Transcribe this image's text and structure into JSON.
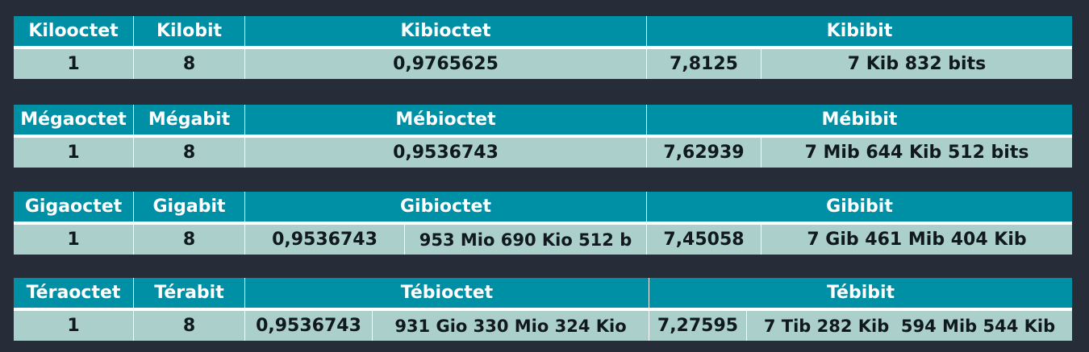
{
  "tables": [
    {
      "headers": [
        "Kilooctet",
        "Kilobit",
        "Kibioctet",
        "Kibibit"
      ],
      "values": [
        "1",
        "8",
        "0,9765625",
        "7,8125",
        "7 Kib 832 bits"
      ]
    },
    {
      "headers": [
        "Mégaoctet",
        "Mégabit",
        "Mébioctet",
        "Mébibit"
      ],
      "values": [
        "1",
        "8",
        "0,9536743",
        "7,62939",
        "7 Mib 644 Kib 512 bits"
      ]
    },
    {
      "headers": [
        "Gigaoctet",
        "Gigabit",
        "Gibioctet",
        "Gibibit"
      ],
      "values": [
        "1",
        "8",
        "0,9536743",
        "953 Mio 690 Kio 512 b",
        "7,45058",
        "7 Gib 461 Mib 404 Kib"
      ]
    },
    {
      "headers": [
        "Téraoctet",
        "Térabit",
        "Tébioctet",
        "Tébibit"
      ],
      "values": [
        "1",
        "8",
        "0,9536743",
        "931 Gio 330 Mio 324 Kio",
        "7,27595",
        "7 Tib 282 Kib  594 Mib 544 Kib"
      ]
    }
  ]
}
